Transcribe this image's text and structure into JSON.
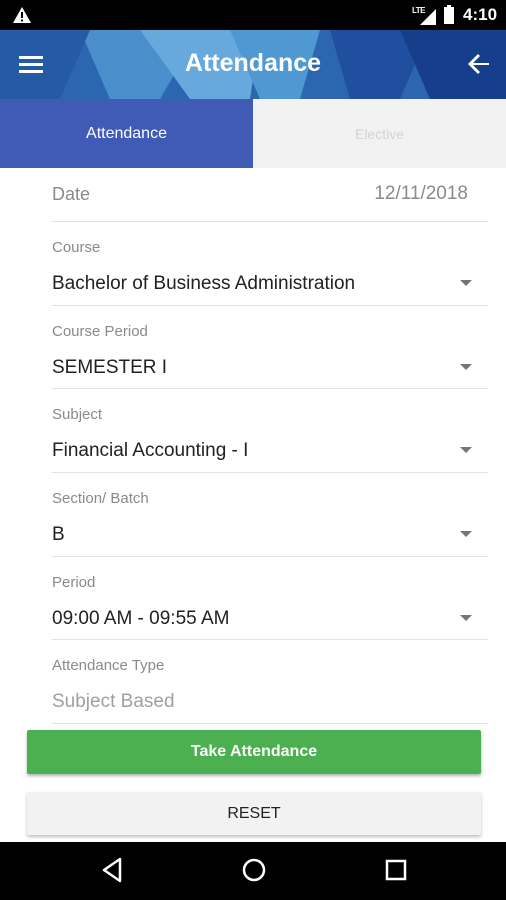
{
  "status_bar": {
    "time": "4:10",
    "network": "LTE"
  },
  "app_bar": {
    "title": "Attendance"
  },
  "tabs": [
    {
      "label": "Attendance",
      "active": true
    },
    {
      "label": "Elective",
      "active": false
    }
  ],
  "form": {
    "date": {
      "label": "Date",
      "value": "12/11/2018"
    },
    "course": {
      "label": "Course",
      "value": "Bachelor of Business Administration"
    },
    "course_period": {
      "label": "Course Period",
      "value": "SEMESTER I"
    },
    "subject": {
      "label": "Subject",
      "value": "Financial Accounting - I"
    },
    "section_batch": {
      "label": "Section/ Batch",
      "value": "B"
    },
    "period": {
      "label": "Period",
      "value": "09:00 AM - 09:55 AM"
    },
    "attendance_type": {
      "label": "Attendance Type",
      "value": "Subject Based"
    }
  },
  "buttons": {
    "take_attendance": "Take Attendance",
    "reset": "RESET"
  },
  "colors": {
    "app_bar": "#2f6bb6",
    "tab_active": "#3f5bb5",
    "primary_button": "#4caf50"
  },
  "icons": [
    "warning-icon",
    "signal-icon",
    "battery-icon",
    "menu-icon",
    "back-arrow-icon",
    "dropdown-caret-icon",
    "nav-back-icon",
    "nav-home-icon",
    "nav-recents-icon"
  ]
}
